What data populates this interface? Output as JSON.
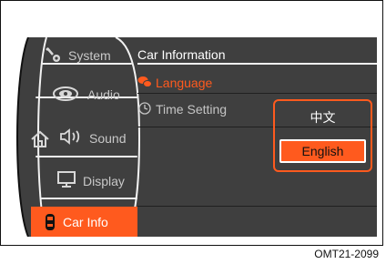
{
  "header": {
    "title": "Car Information"
  },
  "sidebar": {
    "items": [
      {
        "label": "System",
        "icon": "wrench-gear-icon"
      },
      {
        "label": "Audio",
        "icon": "speaker-icon"
      },
      {
        "label": "Sound",
        "icon": "sound-icon"
      },
      {
        "label": "Display",
        "icon": "monitor-icon"
      },
      {
        "label": "Car Info",
        "icon": "car-icon",
        "active": true
      }
    ],
    "home_icon": "home-icon"
  },
  "menu": {
    "items": [
      {
        "label": "Language",
        "icon": "language-icon",
        "selected": true
      },
      {
        "label": "Time Setting",
        "icon": "clock-icon"
      }
    ]
  },
  "language_popup": {
    "options": [
      "中文",
      "English"
    ],
    "selected": "English"
  },
  "caption": "OMT21-2099",
  "colors": {
    "accent": "#ff5a1e",
    "background": "#3f3f3f",
    "text": "#ffffff",
    "muted": "#c4c4c4"
  }
}
